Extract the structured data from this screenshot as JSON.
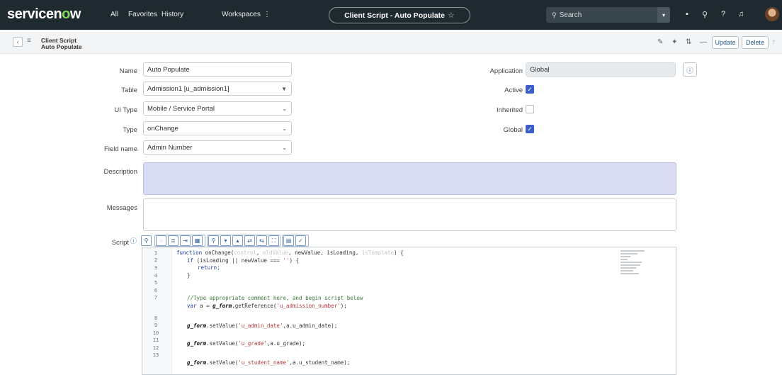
{
  "nav": {
    "logo_prefix": "servicen",
    "logo_o": "o",
    "logo_suffix": "w",
    "links": [
      "All",
      "Favorites",
      "History",
      "Workspaces"
    ],
    "more": "⋮",
    "page_title": "Client Script - Auto Populate",
    "search_placeholder": "Search"
  },
  "form_header": {
    "title_line1": "Client Script",
    "title_line2": "Auto Populate",
    "update_label": "Update",
    "delete_label": "Delete"
  },
  "fields": {
    "name": {
      "label": "Name",
      "value": "Auto Populate"
    },
    "table": {
      "label": "Table",
      "value": "Admission1 [u_admission1]"
    },
    "ui_type": {
      "label": "UI Type",
      "value": "Mobile / Service Portal"
    },
    "type": {
      "label": "Type",
      "value": "onChange"
    },
    "field_name": {
      "label": "Field name",
      "value": "Admin Number"
    },
    "application": {
      "label": "Application",
      "value": "Global"
    },
    "active": {
      "label": "Active",
      "checked": true
    },
    "inherited": {
      "label": "Inherited",
      "checked": false
    },
    "global": {
      "label": "Global",
      "checked": true
    },
    "description": {
      "label": "Description",
      "value": ""
    },
    "messages": {
      "label": "Messages",
      "value": ""
    },
    "script": {
      "label": "Script"
    }
  },
  "script_lines": [
    {
      "n": "1"
    },
    {
      "n": "2"
    },
    {
      "n": "3"
    },
    {
      "n": "4"
    },
    {
      "n": "5"
    },
    {
      "n": "6"
    },
    {
      "n": "7"
    },
    {
      "n": "8"
    },
    {
      "n": "9"
    },
    {
      "n": "10"
    },
    {
      "n": "11"
    },
    {
      "n": "12"
    },
    {
      "n": "13"
    }
  ],
  "code": {
    "l1_kw": "function",
    "l1_name": " onChange(",
    "l1_p1": "control",
    "l1_c1": ", ",
    "l1_p2": "oldValue",
    "l1_c2": ", newValue, isLoading, ",
    "l1_p3": "isTemplate",
    "l1_end": ") {",
    "l2_kw": "if",
    "l2_rest": " (isLoading || newValue === ",
    "l2_str": "''",
    "l2_end": ") {",
    "l3": "return;",
    "l4": "}",
    "l6": "//Type appropriate comment here, and begin script below",
    "l7_kw": "var",
    "l7_a": " a = ",
    "l7_fn": "g_form",
    "l7_b": ".getReference(",
    "l7_str": "'u_admission_number'",
    "l7_end": ");",
    "l9_fn": "g_form",
    "l9_a": ".setValue(",
    "l9_str": "'u_admin_date'",
    "l9_end": ",a.u_admin_date);",
    "l11_fn": "g_form",
    "l11_a": ".setValue(",
    "l11_str": "'u_grade'",
    "l11_end": ",a.u_grade);",
    "l13_fn": "g_form",
    "l13_a": ".setValue(",
    "l13_str": "'u_student_name'",
    "l13_end": ",a.u_student_name);"
  }
}
